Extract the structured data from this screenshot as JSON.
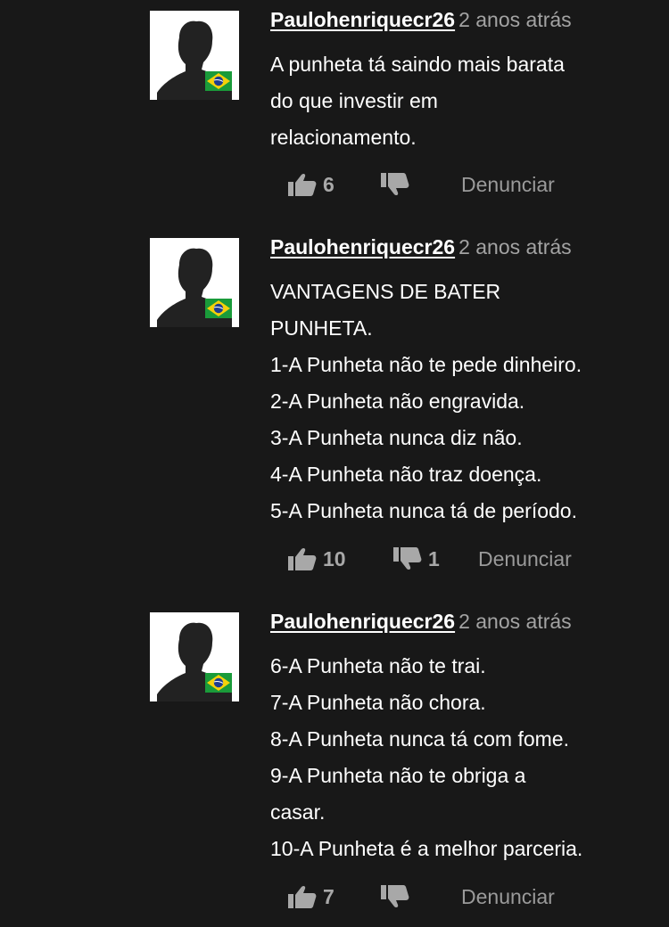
{
  "comments": [
    {
      "username": "Paulohenriquecr26",
      "time": "2 anos atrás",
      "lines": [
        "A punheta tá saindo mais barata",
        "do que investir em",
        "relacionamento."
      ],
      "likes": "6",
      "dislikes": "",
      "report_label": "Denunciar"
    },
    {
      "username": "Paulohenriquecr26",
      "time": "2 anos atrás",
      "lines": [
        "VANTAGENS DE BATER",
        "PUNHETA.",
        "1-A Punheta não te pede dinheiro.",
        "2-A Punheta não engravida.",
        "3-A Punheta nunca diz não.",
        "4-A Punheta não traz doença.",
        "5-A Punheta nunca tá de período."
      ],
      "likes": "10",
      "dislikes": "1",
      "report_label": "Denunciar"
    },
    {
      "username": "Paulohenriquecr26",
      "time": "2 anos atrás",
      "lines": [
        "6-A Punheta não te trai.",
        "7-A Punheta não chora.",
        "8-A Punheta nunca tá com fome.",
        "9-A Punheta não te obriga a",
        "casar.",
        "10-A Punheta é a melhor parceria."
      ],
      "likes": "7",
      "dislikes": "",
      "report_label": "Denunciar"
    }
  ],
  "icons": {
    "avatar": "silhouette-avatar-icon",
    "flag": "brazil-flag-icon",
    "like": "thumbs-up-icon",
    "dislike": "thumbs-down-icon"
  },
  "colors": {
    "background": "#181818",
    "text": "#ffffff",
    "muted": "#a3a3a3",
    "flag_green": "#1a9b3a",
    "flag_yellow": "#f5d10a",
    "flag_blue": "#1f3d8f"
  }
}
